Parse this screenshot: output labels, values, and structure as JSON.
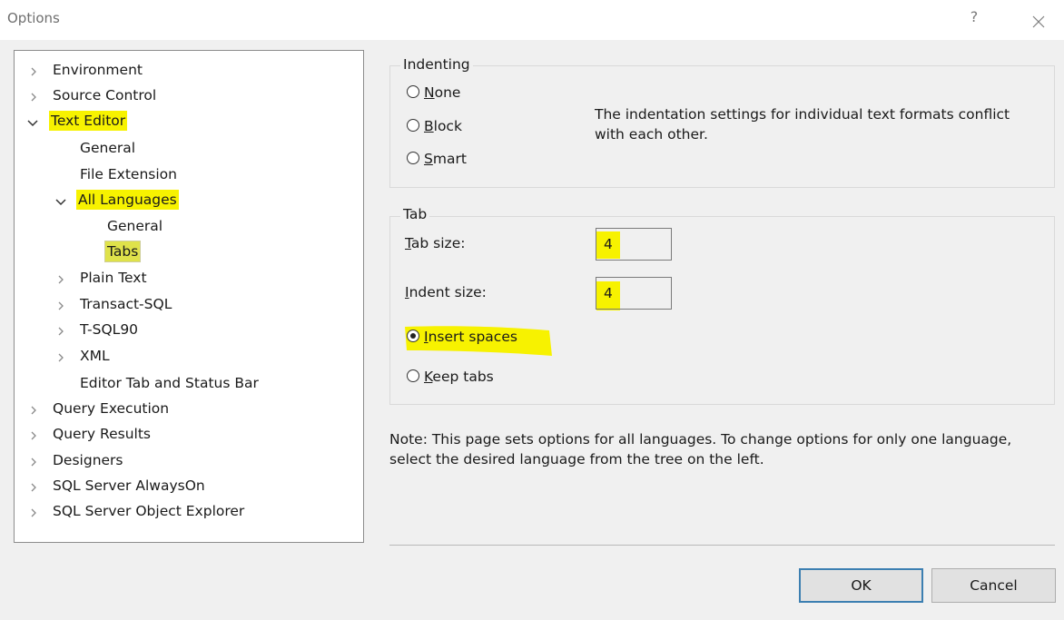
{
  "window": {
    "title": "Options",
    "help_glyph": "?"
  },
  "tree": {
    "items": [
      {
        "label": "Environment",
        "arrow": "collapsed"
      },
      {
        "label": "Source Control",
        "arrow": "collapsed"
      },
      {
        "label": "Text Editor",
        "arrow": "expanded"
      },
      {
        "label": "General",
        "arrow": "none"
      },
      {
        "label": "File Extension",
        "arrow": "none"
      },
      {
        "label": "All Languages",
        "arrow": "expanded"
      },
      {
        "label": "General",
        "arrow": "none"
      },
      {
        "label": "Tabs",
        "arrow": "none",
        "selected": true
      },
      {
        "label": "Plain Text",
        "arrow": "collapsed"
      },
      {
        "label": "Transact-SQL",
        "arrow": "collapsed"
      },
      {
        "label": "T-SQL90",
        "arrow": "collapsed"
      },
      {
        "label": "XML",
        "arrow": "collapsed"
      },
      {
        "label": "Editor Tab and Status Bar",
        "arrow": "none"
      },
      {
        "label": "Query Execution",
        "arrow": "collapsed"
      },
      {
        "label": "Query Results",
        "arrow": "collapsed"
      },
      {
        "label": "Designers",
        "arrow": "collapsed"
      },
      {
        "label": "SQL Server AlwaysOn",
        "arrow": "collapsed"
      },
      {
        "label": "SQL Server Object Explorer",
        "arrow": "collapsed"
      }
    ]
  },
  "indenting": {
    "legend": "Indenting",
    "options": [
      {
        "label": "None",
        "mnemonic": "N",
        "rest": "one",
        "checked": false
      },
      {
        "label": "Block",
        "mnemonic": "B",
        "rest": "lock",
        "checked": false
      },
      {
        "label": "Smart",
        "mnemonic": "S",
        "rest": "mart",
        "checked": false
      }
    ],
    "note": "The indentation settings for individual text formats conflict with each other."
  },
  "tab": {
    "legend": "Tab",
    "tab_size_label": "Tab size:",
    "tab_size_mnemonic": "T",
    "tab_size_rest": "ab size:",
    "tab_size_value": "4",
    "indent_size_label": "Indent size:",
    "indent_size_mnemonic": "I",
    "indent_size_rest": "ndent size:",
    "indent_size_value": "4",
    "insert_spaces": {
      "label": "Insert spaces",
      "mnemonic": "I",
      "rest": "nsert spaces",
      "checked": true
    },
    "keep_tabs": {
      "label": "Keep tabs",
      "mnemonic": "K",
      "rest": "eep tabs",
      "checked": false
    }
  },
  "note": "Note: This page sets options for all languages. To change options for only one language, select the desired language from the tree on the left.",
  "buttons": {
    "ok": "OK",
    "cancel": "Cancel"
  },
  "colors": {
    "highlight": "#f7f200",
    "dialog_bg": "#f0f0f0",
    "ok_border": "#3c7fb1"
  }
}
